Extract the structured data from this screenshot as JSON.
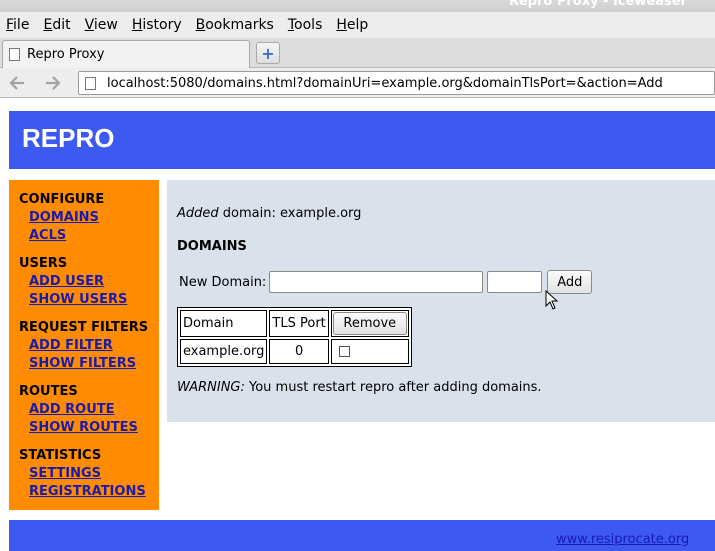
{
  "window": {
    "title": "Repro Proxy - Iceweasel"
  },
  "menubar": {
    "items": [
      {
        "label": "File",
        "mnemonic": "F",
        "rest": "ile"
      },
      {
        "label": "Edit",
        "mnemonic": "E",
        "rest": "dit"
      },
      {
        "label": "View",
        "mnemonic": "V",
        "rest": "iew"
      },
      {
        "label": "History",
        "mnemonic": "H",
        "rest": "istory"
      },
      {
        "label": "Bookmarks",
        "mnemonic": "B",
        "rest": "ookmarks"
      },
      {
        "label": "Tools",
        "mnemonic": "T",
        "rest": "ools"
      },
      {
        "label": "Help",
        "mnemonic": "H",
        "rest": "elp"
      }
    ]
  },
  "tabs": [
    {
      "label": "Repro Proxy"
    }
  ],
  "newtab": {
    "label": "+"
  },
  "nav": {
    "back_icon": "back-arrow-icon",
    "forward_icon": "forward-arrow-icon",
    "url": "localhost:5080/domains.html?domainUri=example.org&domainTlsPort=&action=Add"
  },
  "page": {
    "brand": "REPRO",
    "sidebar": [
      {
        "section": "CONFIGURE",
        "links": [
          "DOMAINS",
          "ACLS"
        ]
      },
      {
        "section": "USERS",
        "links": [
          "ADD USER",
          "SHOW USERS"
        ]
      },
      {
        "section": "REQUEST FILTERS",
        "links": [
          "ADD FILTER",
          "SHOW FILTERS"
        ]
      },
      {
        "section": "ROUTES",
        "links": [
          "ADD ROUTE",
          "SHOW ROUTES"
        ]
      },
      {
        "section": "STATISTICS",
        "links": [
          "SETTINGS",
          "REGISTRATIONS"
        ]
      }
    ],
    "notice": {
      "verb": "Added",
      "text": " domain: example.org"
    },
    "heading": "DOMAINS",
    "form": {
      "label": "New Domain:",
      "domain_value": "",
      "port_value": "",
      "add_label": "Add"
    },
    "table": {
      "headers": [
        "Domain",
        "TLS Port"
      ],
      "remove_label": "Remove",
      "rows": [
        {
          "domain": "example.org",
          "port": "0",
          "checked": false
        }
      ]
    },
    "warning": {
      "label": "WARNING:",
      "text": " You must restart repro after adding domains."
    },
    "footer_link": "www.resiprocate.org"
  },
  "colors": {
    "header": "#3c5af0",
    "sidebar": "#ff8c00",
    "content": "#dbe1ea",
    "link": "#1a1ab0"
  }
}
